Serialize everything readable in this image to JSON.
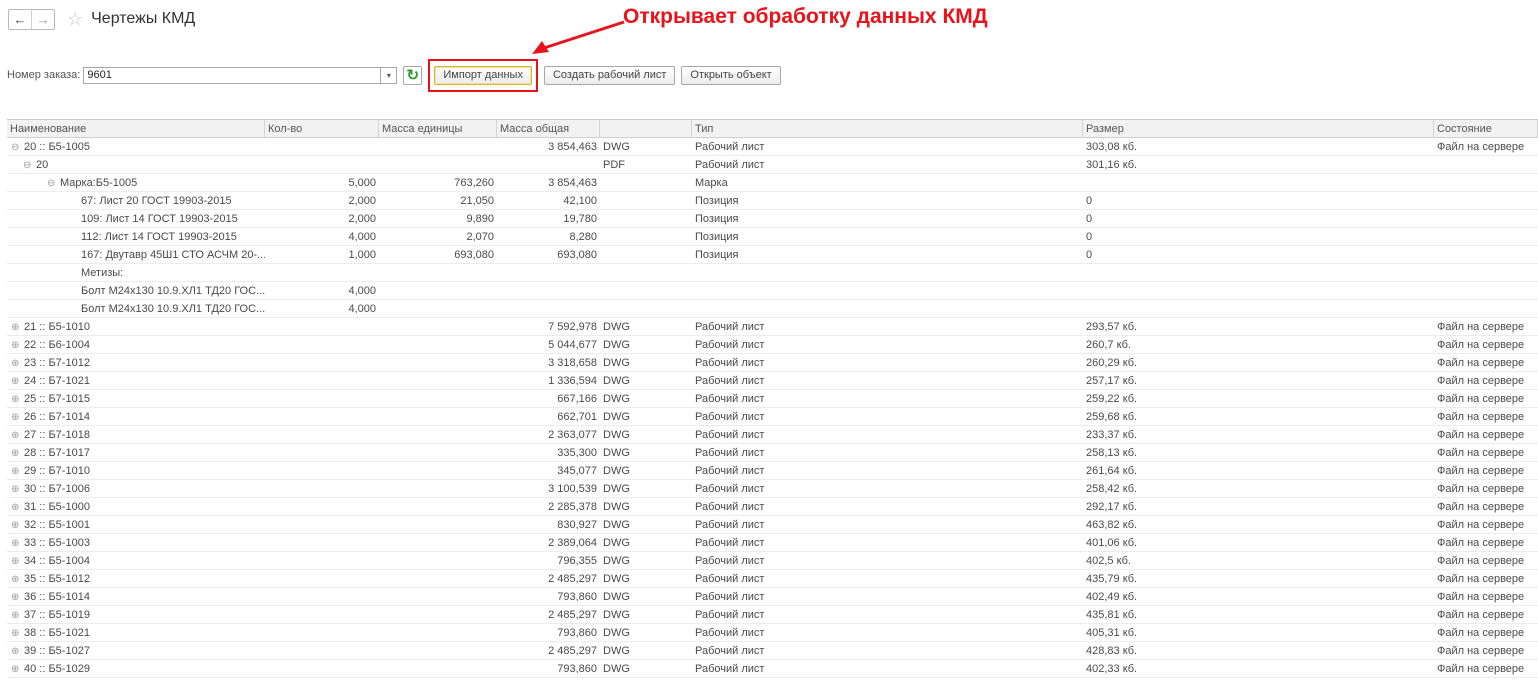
{
  "header": {
    "back_glyph": "←",
    "forward_glyph": "→",
    "star_glyph": "☆",
    "title": "Чертежы КМД"
  },
  "annotation": {
    "text": "Открывает обработку данных КМД",
    "color": "#e8141b"
  },
  "toolbar": {
    "order_label": "Номер заказа:",
    "order_value": "9601",
    "dropdown_glyph": "▾",
    "refresh_glyph": "↻",
    "import_label": "Импорт данных",
    "create_sheet_label": "Создать рабочий лист",
    "open_object_label": "Открыть объект"
  },
  "table": {
    "columns": [
      "Наименование",
      "Кол-во",
      "Масса единицы",
      "Масса общая",
      "",
      "Тип",
      "Размер",
      "Состояние"
    ],
    "rows": [
      {
        "level": 0,
        "toggle": "⊖",
        "name": "20 :: Б5-1005",
        "qty": "",
        "unit": "",
        "total": "3 854,463",
        "fmt": "DWG",
        "type": "Рабочий лист",
        "size": "303,08 кб.",
        "state": "Файл на сервере"
      },
      {
        "level": 1,
        "toggle": "⊖",
        "name": "20",
        "qty": "",
        "unit": "",
        "total": "",
        "fmt": "PDF",
        "type": "Рабочий лист",
        "size": "301,16 кб.",
        "state": ""
      },
      {
        "level": 2,
        "toggle": "⊖",
        "name": "Марка:Б5-1005",
        "qty": "5,000",
        "unit": "763,260",
        "total": "3 854,463",
        "fmt": "",
        "type": "Марка",
        "size": "",
        "state": ""
      },
      {
        "level": 3,
        "toggle": "",
        "name": "67: Лист 20 ГОСТ 19903-2015",
        "qty": "2,000",
        "unit": "21,050",
        "total": "42,100",
        "fmt": "",
        "type": "Позиция",
        "size": "0",
        "state": ""
      },
      {
        "level": 3,
        "toggle": "",
        "name": "109: Лист 14 ГОСТ 19903-2015",
        "qty": "2,000",
        "unit": "9,890",
        "total": "19,780",
        "fmt": "",
        "type": "Позиция",
        "size": "0",
        "state": ""
      },
      {
        "level": 3,
        "toggle": "",
        "name": "112: Лист 14 ГОСТ 19903-2015",
        "qty": "4,000",
        "unit": "2,070",
        "total": "8,280",
        "fmt": "",
        "type": "Позиция",
        "size": "0",
        "state": ""
      },
      {
        "level": 3,
        "toggle": "",
        "name": "167: Двутавр 45Ш1 СТО АСЧМ 20-...",
        "qty": "1,000",
        "unit": "693,080",
        "total": "693,080",
        "fmt": "",
        "type": "Позиция",
        "size": "0",
        "state": ""
      },
      {
        "level": 3,
        "toggle": "",
        "name": "Метизы:",
        "qty": "",
        "unit": "",
        "total": "",
        "fmt": "",
        "type": "",
        "size": "",
        "state": ""
      },
      {
        "level": 3,
        "toggle": "",
        "name": "Болт М24х130 10.9.ХЛ1 ТД20 ГОС...",
        "qty": "4,000",
        "unit": "",
        "total": "",
        "fmt": "",
        "type": "",
        "size": "",
        "state": ""
      },
      {
        "level": 3,
        "toggle": "",
        "name": "Болт М24х130 10.9.ХЛ1 ТД20 ГОС...",
        "qty": "4,000",
        "unit": "",
        "total": "",
        "fmt": "",
        "type": "",
        "size": "",
        "state": ""
      },
      {
        "level": 0,
        "toggle": "⊕",
        "name": "21 :: Б5-1010",
        "qty": "",
        "unit": "",
        "total": "7 592,978",
        "fmt": "DWG",
        "type": "Рабочий лист",
        "size": "293,57 кб.",
        "state": "Файл на сервере"
      },
      {
        "level": 0,
        "toggle": "⊕",
        "name": "22 :: Б6-1004",
        "qty": "",
        "unit": "",
        "total": "5 044,677",
        "fmt": "DWG",
        "type": "Рабочий лист",
        "size": "260,7 кб.",
        "state": "Файл на сервере"
      },
      {
        "level": 0,
        "toggle": "⊕",
        "name": "23 :: Б7-1012",
        "qty": "",
        "unit": "",
        "total": "3 318,658",
        "fmt": "DWG",
        "type": "Рабочий лист",
        "size": "260,29 кб.",
        "state": "Файл на сервере"
      },
      {
        "level": 0,
        "toggle": "⊕",
        "name": "24 :: Б7-1021",
        "qty": "",
        "unit": "",
        "total": "1 336,594",
        "fmt": "DWG",
        "type": "Рабочий лист",
        "size": "257,17 кб.",
        "state": "Файл на сервере"
      },
      {
        "level": 0,
        "toggle": "⊕",
        "name": "25 :: Б7-1015",
        "qty": "",
        "unit": "",
        "total": "667,166",
        "fmt": "DWG",
        "type": "Рабочий лист",
        "size": "259,22 кб.",
        "state": "Файл на сервере"
      },
      {
        "level": 0,
        "toggle": "⊕",
        "name": "26 :: Б7-1014",
        "qty": "",
        "unit": "",
        "total": "662,701",
        "fmt": "DWG",
        "type": "Рабочий лист",
        "size": "259,68 кб.",
        "state": "Файл на сервере"
      },
      {
        "level": 0,
        "toggle": "⊕",
        "name": "27 :: Б7-1018",
        "qty": "",
        "unit": "",
        "total": "2 363,077",
        "fmt": "DWG",
        "type": "Рабочий лист",
        "size": "233,37 кб.",
        "state": "Файл на сервере"
      },
      {
        "level": 0,
        "toggle": "⊕",
        "name": "28 :: Б7-1017",
        "qty": "",
        "unit": "",
        "total": "335,300",
        "fmt": "DWG",
        "type": "Рабочий лист",
        "size": "258,13 кб.",
        "state": "Файл на сервере"
      },
      {
        "level": 0,
        "toggle": "⊕",
        "name": "29 :: Б7-1010",
        "qty": "",
        "unit": "",
        "total": "345,077",
        "fmt": "DWG",
        "type": "Рабочий лист",
        "size": "261,64 кб.",
        "state": "Файл на сервере"
      },
      {
        "level": 0,
        "toggle": "⊕",
        "name": "30 :: Б7-1006",
        "qty": "",
        "unit": "",
        "total": "3 100,539",
        "fmt": "DWG",
        "type": "Рабочий лист",
        "size": "258,42 кб.",
        "state": "Файл на сервере"
      },
      {
        "level": 0,
        "toggle": "⊕",
        "name": "31 :: Б5-1000",
        "qty": "",
        "unit": "",
        "total": "2 285,378",
        "fmt": "DWG",
        "type": "Рабочий лист",
        "size": "292,17 кб.",
        "state": "Файл на сервере"
      },
      {
        "level": 0,
        "toggle": "⊕",
        "name": "32 :: Б5-1001",
        "qty": "",
        "unit": "",
        "total": "830,927",
        "fmt": "DWG",
        "type": "Рабочий лист",
        "size": "463,82 кб.",
        "state": "Файл на сервере"
      },
      {
        "level": 0,
        "toggle": "⊕",
        "name": "33 :: Б5-1003",
        "qty": "",
        "unit": "",
        "total": "2 389,064",
        "fmt": "DWG",
        "type": "Рабочий лист",
        "size": "401,06 кб.",
        "state": "Файл на сервере"
      },
      {
        "level": 0,
        "toggle": "⊕",
        "name": "34 :: Б5-1004",
        "qty": "",
        "unit": "",
        "total": "796,355",
        "fmt": "DWG",
        "type": "Рабочий лист",
        "size": "402,5 кб.",
        "state": "Файл на сервере"
      },
      {
        "level": 0,
        "toggle": "⊕",
        "name": "35 :: Б5-1012",
        "qty": "",
        "unit": "",
        "total": "2 485,297",
        "fmt": "DWG",
        "type": "Рабочий лист",
        "size": "435,79 кб.",
        "state": "Файл на сервере"
      },
      {
        "level": 0,
        "toggle": "⊕",
        "name": "36 :: Б5-1014",
        "qty": "",
        "unit": "",
        "total": "793,860",
        "fmt": "DWG",
        "type": "Рабочий лист",
        "size": "402,49 кб.",
        "state": "Файл на сервере"
      },
      {
        "level": 0,
        "toggle": "⊕",
        "name": "37 :: Б5-1019",
        "qty": "",
        "unit": "",
        "total": "2 485,297",
        "fmt": "DWG",
        "type": "Рабочий лист",
        "size": "435,81 кб.",
        "state": "Файл на сервере"
      },
      {
        "level": 0,
        "toggle": "⊕",
        "name": "38 :: Б5-1021",
        "qty": "",
        "unit": "",
        "total": "793,860",
        "fmt": "DWG",
        "type": "Рабочий лист",
        "size": "405,31 кб.",
        "state": "Файл на сервере"
      },
      {
        "level": 0,
        "toggle": "⊕",
        "name": "39 :: Б5-1027",
        "qty": "",
        "unit": "",
        "total": "2 485,297",
        "fmt": "DWG",
        "type": "Рабочий лист",
        "size": "428,83 кб.",
        "state": "Файл на сервере"
      },
      {
        "level": 0,
        "toggle": "⊕",
        "name": "40 :: Б5-1029",
        "qty": "",
        "unit": "",
        "total": "793,860",
        "fmt": "DWG",
        "type": "Рабочий лист",
        "size": "402,33 кб.",
        "state": "Файл на сервере"
      }
    ]
  }
}
